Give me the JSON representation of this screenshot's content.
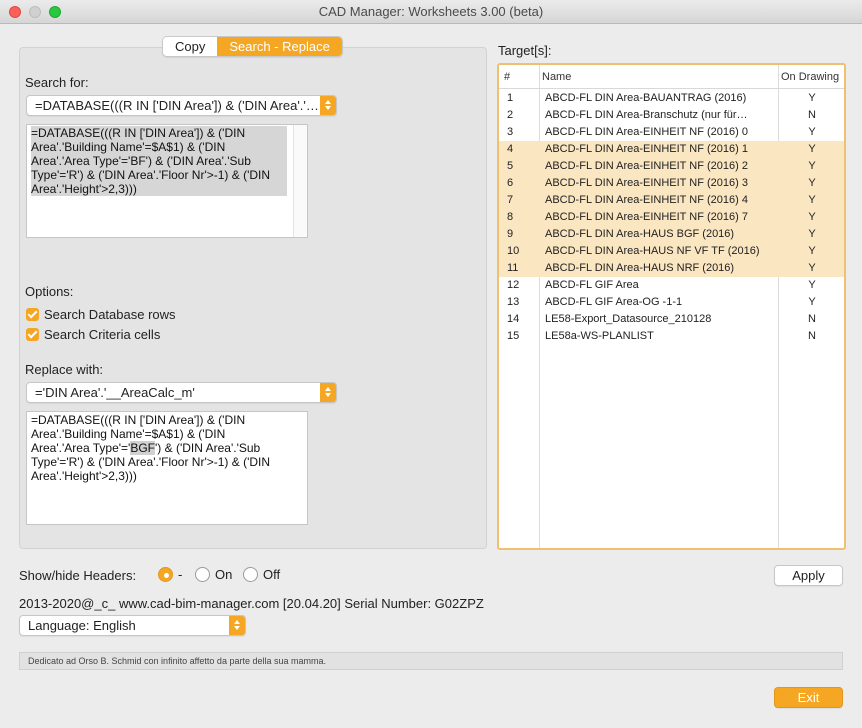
{
  "window": {
    "title": "CAD Manager: Worksheets 3.00 (beta)"
  },
  "tabs": {
    "copy": "Copy",
    "search_replace": "Search - Replace"
  },
  "search": {
    "label": "Search for:",
    "combo_value": "=DATABASE(((R IN ['DIN Area']) & ('DIN Area'.'…",
    "text_lines": [
      "=DATABASE(((R IN ['DIN Area']) & ('DIN",
      "Area'.'Building Name'=$A$1) & ('DIN",
      "Area'.'Area Type'='BF') & ('DIN Area'.'Sub",
      "Type'='R') & ('DIN Area'.'Floor Nr'>-1) & ('DIN",
      "Area'.'Height'>2,3)))"
    ]
  },
  "options": {
    "label": "Options:",
    "search_db_rows": "Search Database rows",
    "search_criteria_cells": "Search Criteria cells"
  },
  "replace": {
    "label": "Replace with:",
    "combo_value": "='DIN Area'.'__AreaCalc_m'",
    "text_lines": [
      "=DATABASE(((R IN ['DIN Area']) & ('DIN",
      "Area'.'Building Name'=$A$1) & ('DIN",
      "Area'.'Area Type'='",
      "BGF",
      "') & ('DIN Area'.'Sub",
      "Type'='R') & ('DIN Area'.'Floor Nr'>-1) & ('DIN",
      "Area'.'Height'>2,3)))"
    ]
  },
  "targets": {
    "label": "Target[s]:",
    "columns": {
      "num": "#",
      "name": "Name",
      "drawing": "On Drawing"
    },
    "rows": [
      {
        "num": "1",
        "name": "ABCD-FL DIN Area-BAUANTRAG (2016)",
        "drawing": "Y",
        "selected": false
      },
      {
        "num": "2",
        "name": "ABCD-FL DIN Area-Branschutz (nur für…",
        "drawing": "N",
        "selected": false
      },
      {
        "num": "3",
        "name": "ABCD-FL DIN Area-EINHEIT NF (2016) 0",
        "drawing": "Y",
        "selected": false
      },
      {
        "num": "4",
        "name": "ABCD-FL DIN Area-EINHEIT NF (2016) 1",
        "drawing": "Y",
        "selected": true
      },
      {
        "num": "5",
        "name": "ABCD-FL DIN Area-EINHEIT NF (2016) 2",
        "drawing": "Y",
        "selected": true
      },
      {
        "num": "6",
        "name": "ABCD-FL DIN Area-EINHEIT NF (2016) 3",
        "drawing": "Y",
        "selected": true
      },
      {
        "num": "7",
        "name": "ABCD-FL DIN Area-EINHEIT NF (2016) 4",
        "drawing": "Y",
        "selected": true
      },
      {
        "num": "8",
        "name": "ABCD-FL DIN Area-EINHEIT NF (2016) 7",
        "drawing": "Y",
        "selected": true
      },
      {
        "num": "9",
        "name": "ABCD-FL DIN Area-HAUS BGF (2016)",
        "drawing": "Y",
        "selected": true
      },
      {
        "num": "10",
        "name": "ABCD-FL DIN Area-HAUS NF VF TF (2016)",
        "drawing": "Y",
        "selected": true
      },
      {
        "num": "11",
        "name": "ABCD-FL DIN Area-HAUS NRF (2016)",
        "drawing": "Y",
        "selected": true
      },
      {
        "num": "12",
        "name": "ABCD-FL GIF Area",
        "drawing": "Y",
        "selected": false
      },
      {
        "num": "13",
        "name": "ABCD-FL GIF Area-OG -1-1",
        "drawing": "Y",
        "selected": false
      },
      {
        "num": "14",
        "name": "LE58-Export_Datasource_210128",
        "drawing": "N",
        "selected": false
      },
      {
        "num": "15",
        "name": "LE58a-WS-PLANLIST",
        "drawing": "N",
        "selected": false
      }
    ]
  },
  "headers": {
    "label": "Show/hide Headers:",
    "opt_dash": "-",
    "opt_on": "On",
    "opt_off": "Off"
  },
  "apply_label": "Apply",
  "copyright": "2013-2020@_c_ www.cad-bim-manager.com [20.04.20]  Serial Number: G02ZPZ",
  "language": {
    "value": "Language: English"
  },
  "dedication": "Dedicato ad Orso B. Schmid con infinito affetto da parte della sua mamma.",
  "exit_label": "Exit",
  "colors": {
    "accent": "#f5a623",
    "selection_row": "#fbe6c2"
  }
}
